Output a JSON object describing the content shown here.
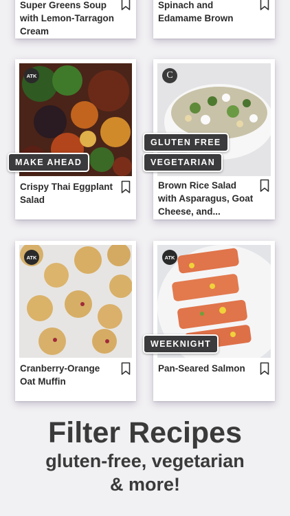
{
  "cards": [
    {
      "title": "Super Greens Soup with Lemon-Tarragon Cream"
    },
    {
      "title": "Spinach and Edamame Brown"
    },
    {
      "title": "Crispy Thai Eggplant Salad",
      "badge": "ATK",
      "tags": [
        "MAKE AHEAD"
      ]
    },
    {
      "title": "Brown Rice Salad with Asparagus, Goat Cheese, and...",
      "badge": "C",
      "tags": [
        "GLUTEN FREE",
        "VEGETARIAN"
      ]
    },
    {
      "title": "Cranberry-Orange Oat Muffin",
      "badge": "ATK"
    },
    {
      "title": "Pan-Seared Salmon",
      "badge": "ATK",
      "tags": [
        "WEEKNIGHT"
      ]
    }
  ],
  "promo": {
    "headline": "Filter Recipes",
    "subline1": "gluten-free, vegetarian",
    "subline2": "& more!"
  }
}
